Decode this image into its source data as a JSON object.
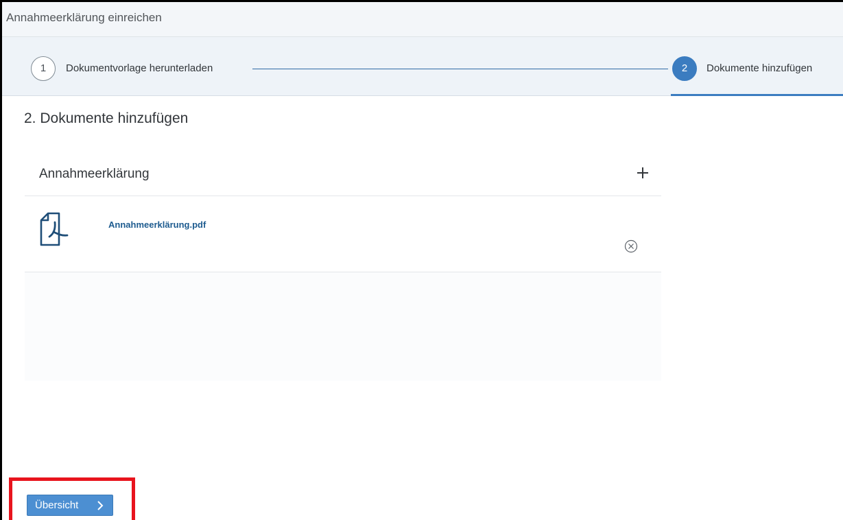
{
  "window": {
    "title": "Annahmeerklärung einreichen"
  },
  "wizard": {
    "steps": [
      {
        "number": "1",
        "label": "Dokumentvorlage herunterladen",
        "state": "completed"
      },
      {
        "number": "2",
        "label": "Dokumente hinzufügen",
        "state": "active"
      }
    ]
  },
  "main": {
    "section_title": "2. Dokumente hinzufügen",
    "documents": {
      "header": "Annahmeerklärung",
      "add_icon": "plus-icon",
      "items": [
        {
          "file_name": "Annahmeerklärung.pdf",
          "icon": "pdf-file-icon",
          "remove_icon": "remove-circle-icon"
        }
      ]
    }
  },
  "footer": {
    "overview_button_label": "Übersicht",
    "overview_button_icon": "chevron-right-icon"
  },
  "colors": {
    "accent": "#3b7cc0",
    "link": "#1d5b8f",
    "highlight": "#e8141d"
  }
}
